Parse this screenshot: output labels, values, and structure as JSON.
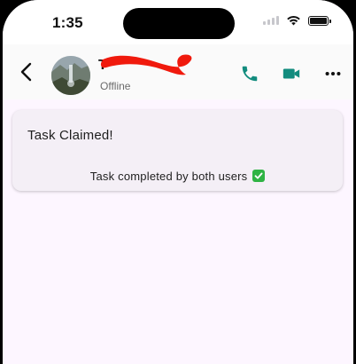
{
  "status_bar": {
    "time": "1:35"
  },
  "header": {
    "contact_name": "T",
    "presence": "Offline",
    "accent_color": "#128c7e"
  },
  "messages": [
    {
      "title": "Task Claimed!",
      "status_text": "Task completed by both users",
      "status_icon": "check-mark-button-icon"
    }
  ],
  "icons": {
    "back": "chevron-left-icon",
    "call": "phone-icon",
    "video": "video-camera-icon",
    "more": "more-dots-icon"
  }
}
